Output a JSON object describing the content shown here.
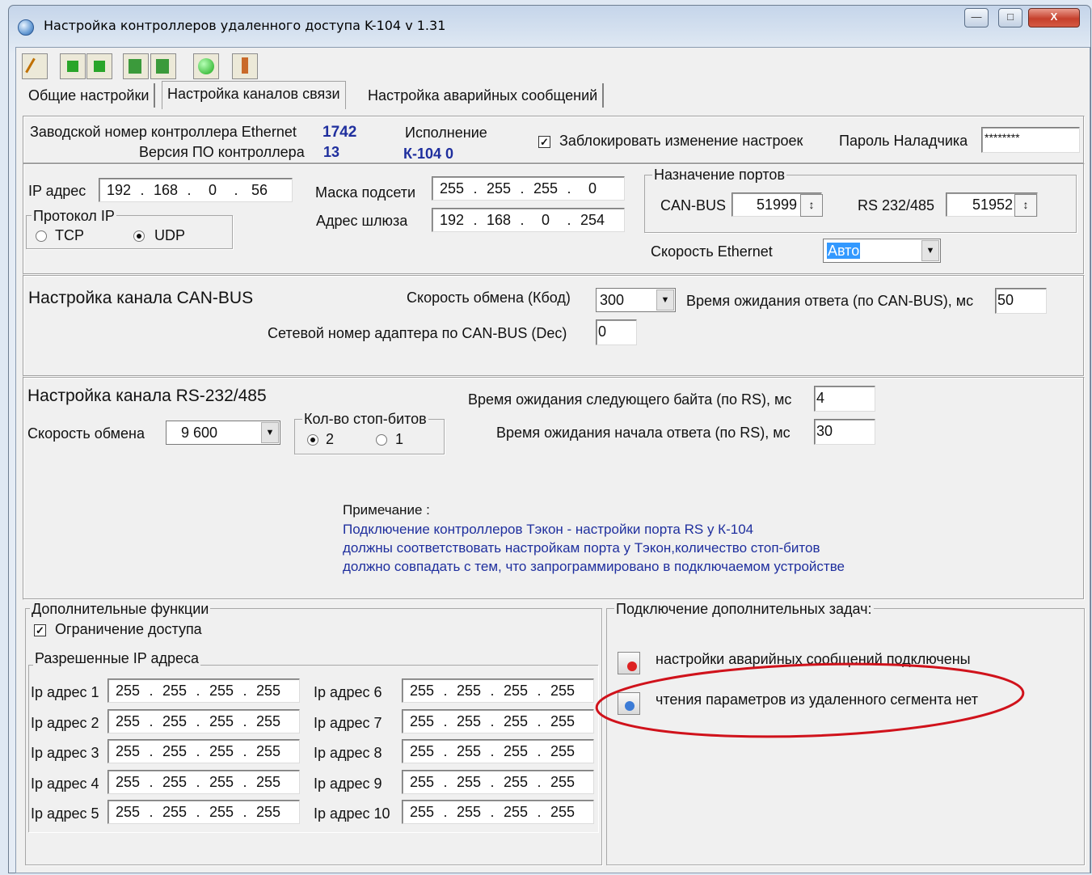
{
  "window": {
    "title": "Настройка контроллеров удаленного доступа K-104   v 1.31"
  },
  "tabs": [
    "Общие настройки",
    "Настройка каналов связи",
    "Настройка аварийных сообщений"
  ],
  "header": {
    "serial_label": "Заводской номер контроллера Ethernet",
    "serial_value": "1742",
    "fw_label": "Версия ПО контроллера",
    "fw_value": "13",
    "exec_label": "Исполнение",
    "exec_value": "К-104 0",
    "lock_label": "Заблокировать изменение настроек",
    "password_label": "Пароль Наладчика",
    "password_value": "********"
  },
  "network": {
    "ip_label": "IP адрес",
    "ip": [
      "192",
      "168",
      "0",
      "56"
    ],
    "mask_label": "Маска подсети",
    "mask": [
      "255",
      "255",
      "255",
      "0"
    ],
    "gw_label": "Адрес шлюза",
    "gw": [
      "192",
      "168",
      "0",
      "254"
    ],
    "protocol_legend": "Протокол IP",
    "tcp": "TCP",
    "udp": "UDP",
    "ports_legend": "Назначение портов",
    "canbus_label": "CAN-BUS",
    "canbus_port": "51999",
    "rs_label": "RS 232/485",
    "rs_port": "51952",
    "eth_speed_label": "Скорость Ethernet",
    "eth_speed": "Авто"
  },
  "canbus": {
    "title": "Настройка  канала CAN-BUS",
    "speed_label": "Скорость обмена (Кбод)",
    "speed": "300",
    "timeout_label": "Время ожидания ответа (по CAN-BUS), мс",
    "timeout": "50",
    "netnum_label": "Сетевой номер адаптера по  CAN-BUS  (Dec)",
    "netnum": "0"
  },
  "rs": {
    "title": "Настройка канала RS-232/485",
    "speed_label": "Скорость обмена",
    "speed": "9 600",
    "stopbits_legend": "Кол-во стоп-битов",
    "stop2": "2",
    "stop1": "1",
    "byte_timeout_label": "Время ожидания следующего байта (по RS), мс",
    "byte_timeout": "4",
    "start_timeout_label": "Время ожидания начала ответа (по RS), мс",
    "start_timeout": "30",
    "note_title": "Примечание :",
    "note_lines": [
      "Подключение контроллеров Тэкон - настройки порта RS у К-104",
      "должны соответствовать настройкам порта у Тэкон,количество стоп-битов",
      "должно совпадать с тем, что запрограммировано в подключаемом устройстве"
    ]
  },
  "extra": {
    "legend": "Дополнительные функции",
    "restrict_label": "Ограничение доступа",
    "allowed_legend": "Разрешенные IP адреса",
    "ips": [
      {
        "label": "Ip адрес 1",
        "value": [
          "255",
          "255",
          "255",
          "255"
        ]
      },
      {
        "label": "Ip адрес 2",
        "value": [
          "255",
          "255",
          "255",
          "255"
        ]
      },
      {
        "label": "Ip адрес 3",
        "value": [
          "255",
          "255",
          "255",
          "255"
        ]
      },
      {
        "label": "Ip адрес 4",
        "value": [
          "255",
          "255",
          "255",
          "255"
        ]
      },
      {
        "label": "Ip адрес 5",
        "value": [
          "255",
          "255",
          "255",
          "255"
        ]
      },
      {
        "label": "Ip адрес 6",
        "value": [
          "255",
          "255",
          "255",
          "255"
        ]
      },
      {
        "label": "Ip адрес 7",
        "value": [
          "255",
          "255",
          "255",
          "255"
        ]
      },
      {
        "label": "Ip адрес 8",
        "value": [
          "255",
          "255",
          "255",
          "255"
        ]
      },
      {
        "label": "Ip адрес 9",
        "value": [
          "255",
          "255",
          "255",
          "255"
        ]
      },
      {
        "label": "Ip адрес 10",
        "value": [
          "255",
          "255",
          "255",
          "255"
        ]
      }
    ]
  },
  "tasks": {
    "legend": "Подключение дополнительных задач:",
    "alarm_label": "настройки аварийных сообщений подключены",
    "remote_label": "чтения параметров из удаленного сегмента нет"
  },
  "colors": {
    "highlight_ellipse": "#d0121b",
    "value_blue": "#1f2f9e",
    "selection": "#3399ff"
  }
}
